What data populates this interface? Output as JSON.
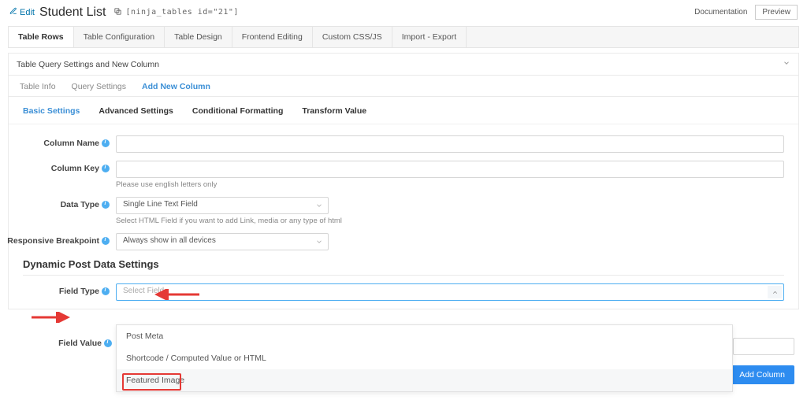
{
  "header": {
    "edit": "Edit",
    "title": "Student List",
    "shortcode": "[ninja_tables id=\"21\"]",
    "documentation": "Documentation",
    "preview": "Preview"
  },
  "main_tabs": [
    "Table Rows",
    "Table Configuration",
    "Table Design",
    "Frontend Editing",
    "Custom CSS/JS",
    "Import - Export"
  ],
  "outer_panel": {
    "title": "Table Query Settings and New Column"
  },
  "inner_tabs": [
    "Table Info",
    "Query Settings",
    "Add New Column"
  ],
  "sub_tabs": [
    "Basic Settings",
    "Advanced Settings",
    "Conditional Formatting",
    "Transform Value"
  ],
  "form": {
    "column_name": {
      "label": "Column Name",
      "value": ""
    },
    "column_key": {
      "label": "Column Key",
      "value": "",
      "help": "Please use english letters only"
    },
    "data_type": {
      "label": "Data Type",
      "selected": "Single Line Text Field",
      "help": "Select HTML Field if you want to add Link, media or any type of html"
    },
    "responsive": {
      "label": "Responsive Breakpoint",
      "selected": "Always show in all devices"
    }
  },
  "dynamic_section": {
    "heading": "Dynamic Post Data Settings",
    "field_type": {
      "label": "Field Type",
      "placeholder": "Select Field"
    },
    "field_value": {
      "label": "Field Value"
    },
    "options": [
      "Post Meta",
      "Shortcode / Computed Value or HTML",
      "Featured Image"
    ]
  },
  "add_column_btn": "Add Column"
}
